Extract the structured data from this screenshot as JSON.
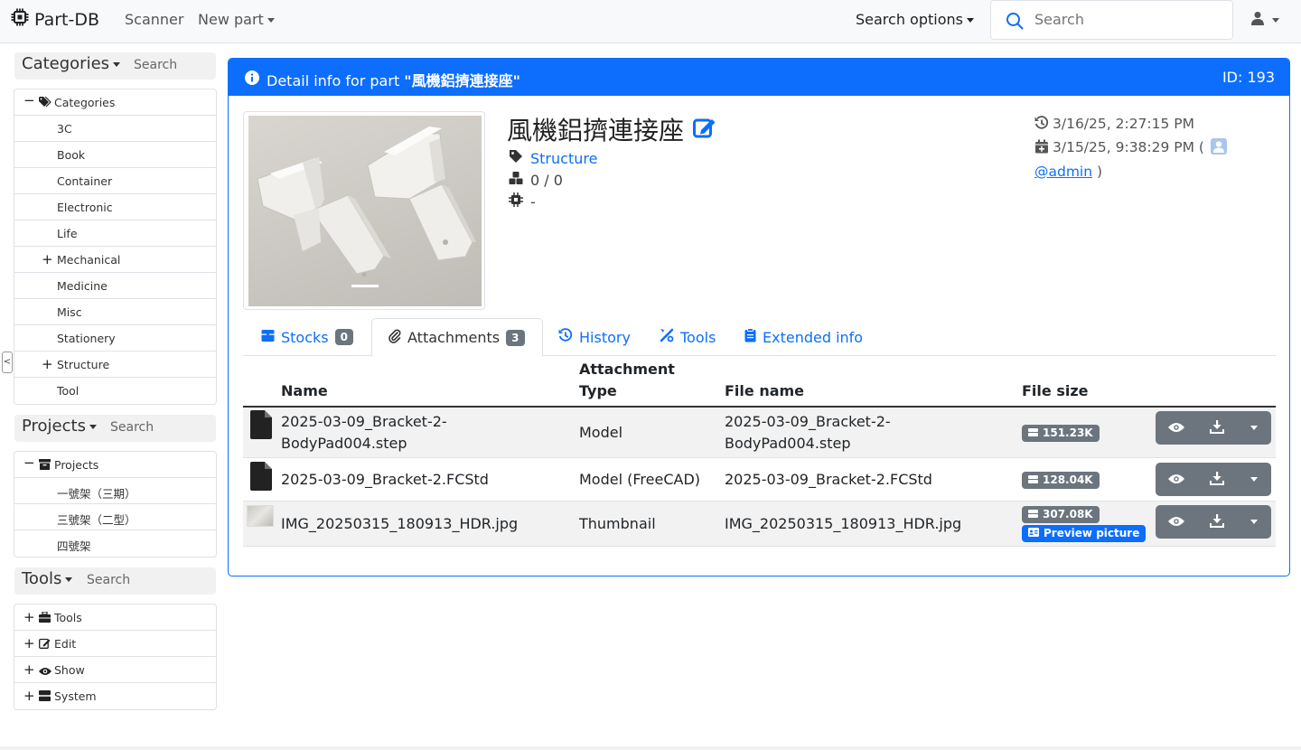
{
  "navbar": {
    "brand": "Part-DB",
    "scanner": "Scanner",
    "new_part": "New part",
    "search_options": "Search options",
    "search_placeholder": "Search"
  },
  "sidebar": {
    "categories": {
      "title": "Categories",
      "search": "Search",
      "root": "Categories",
      "items": [
        {
          "label": "3C",
          "toggle": ""
        },
        {
          "label": "Book",
          "toggle": ""
        },
        {
          "label": "Container",
          "toggle": ""
        },
        {
          "label": "Electronic",
          "toggle": ""
        },
        {
          "label": "Life",
          "toggle": ""
        },
        {
          "label": "Mechanical",
          "toggle": "+"
        },
        {
          "label": "Medicine",
          "toggle": ""
        },
        {
          "label": "Misc",
          "toggle": ""
        },
        {
          "label": "Stationery",
          "toggle": ""
        },
        {
          "label": "Structure",
          "toggle": "+"
        },
        {
          "label": "Tool",
          "toggle": ""
        }
      ]
    },
    "projects": {
      "title": "Projects",
      "search": "Search",
      "root": "Projects",
      "items": [
        {
          "label": "一號架（三期）"
        },
        {
          "label": "三號架（二型）"
        },
        {
          "label": "四號架"
        }
      ]
    },
    "tools": {
      "title": "Tools",
      "search": "Search",
      "items": [
        {
          "label": "Tools",
          "icon": "toolbox-icon"
        },
        {
          "label": "Edit",
          "icon": "edit-icon"
        },
        {
          "label": "Show",
          "icon": "eye-icon"
        },
        {
          "label": "System",
          "icon": "server-icon"
        }
      ]
    }
  },
  "card": {
    "header_prefix": "Detail info for part ",
    "header_part": "\"風機鋁擠連接座\"",
    "id_label": "ID: 193",
    "part_name": "風機鋁擠連接座",
    "category": "Structure",
    "stock": "0 / 0",
    "footprint": "-",
    "last_modified": "3/16/25, 2:27:15 PM",
    "created": "3/15/25, 9:38:29 PM (",
    "created_user": "@admin",
    "created_close": ")"
  },
  "tabs": [
    {
      "label": "Stocks",
      "badge": "0",
      "icon": "box-icon"
    },
    {
      "label": "Attachments",
      "badge": "3",
      "icon": "paperclip-icon"
    },
    {
      "label": "History",
      "badge": "",
      "icon": "history-icon"
    },
    {
      "label": "Tools",
      "badge": "",
      "icon": "tools-icon"
    },
    {
      "label": "Extended info",
      "badge": "",
      "icon": "clipboard-icon"
    }
  ],
  "table": {
    "headers": {
      "name": "Name",
      "type_line1": "Attachment",
      "type_line2": "Type",
      "file_name": "File name",
      "file_size": "File size"
    },
    "rows": [
      {
        "name_l1": "2025-03-09_Bracket-2-",
        "name_l2": "BodyPad004.step",
        "type": "Model",
        "file_l1": "2025-03-09_Bracket-2-",
        "file_l2": "BodyPad004.step",
        "size": "151.23K"
      },
      {
        "name": "2025-03-09_Bracket-2.FCStd",
        "type": "Model (FreeCAD)",
        "file": "2025-03-09_Bracket-2.FCStd",
        "size": "128.04K"
      },
      {
        "name": "IMG_20250315_180913_HDR.jpg",
        "type": "Thumbnail",
        "file": "IMG_20250315_180913_HDR.jpg",
        "size": "307.08K",
        "preview": "Preview picture"
      }
    ]
  },
  "colors": {
    "primary": "#0d6efd",
    "secondary": "#6c757d"
  }
}
